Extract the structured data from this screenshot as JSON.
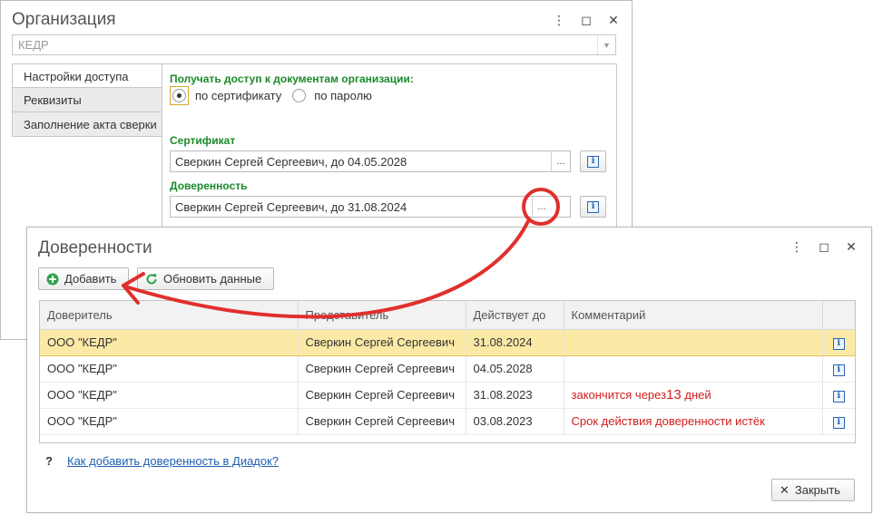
{
  "org_window": {
    "title": "Организация",
    "org_value": "КЕДР",
    "tabs": [
      {
        "label": "Настройки доступа"
      },
      {
        "label": "Реквизиты"
      },
      {
        "label": "Заполнение акта сверки"
      }
    ],
    "access_label": "Получать доступ к документам организации:",
    "radio_cert": "по сертификату",
    "radio_password": "по паролю",
    "cert_label": "Сертификат",
    "cert_value": "Сверкин Сергей Сергеевич, до 04.05.2028",
    "poa_label": "Доверенность",
    "poa_value": "Сверкин Сергей Сергеевич, до 31.08.2024",
    "dots": "...",
    "info_glyph": "i"
  },
  "poa_window": {
    "title": "Доверенности",
    "add_label": "Добавить",
    "refresh_label": "Обновить данные",
    "columns": [
      "Доверитель",
      "Представитель",
      "Действует до",
      "Комментарий"
    ],
    "rows": [
      {
        "principal": "ООО \"КЕДР\"",
        "rep": "Сверкин Сергей Сергеевич",
        "until": "31.08.2024",
        "comment": "",
        "selected": true
      },
      {
        "principal": "ООО \"КЕДР\"",
        "rep": "Сверкин Сергей Сергеевич",
        "until": "04.05.2028",
        "comment": "",
        "selected": false
      },
      {
        "principal": "ООО \"КЕДР\"",
        "rep": "Сверкин Сергей Сергеевич",
        "until": "31.08.2023",
        "comment_pre": "закончится через",
        "comment_num": "13",
        "comment_post": " дней",
        "selected": false
      },
      {
        "principal": "ООО \"КЕДР\"",
        "rep": "Сверкин Сергей Сергеевич",
        "until": "03.08.2023",
        "comment": "Срок действия доверенности истёк",
        "selected": false
      }
    ],
    "help_mark": "?",
    "help_link": "Как добавить доверенность в Диадок?",
    "close_label": "Закрыть"
  },
  "colors": {
    "green_label": "#1b8a2a",
    "selected_row": "#fbe9a6",
    "warning_text": "#d41c1c",
    "annotation": "#e0302d",
    "link": "#1f5fb0"
  }
}
